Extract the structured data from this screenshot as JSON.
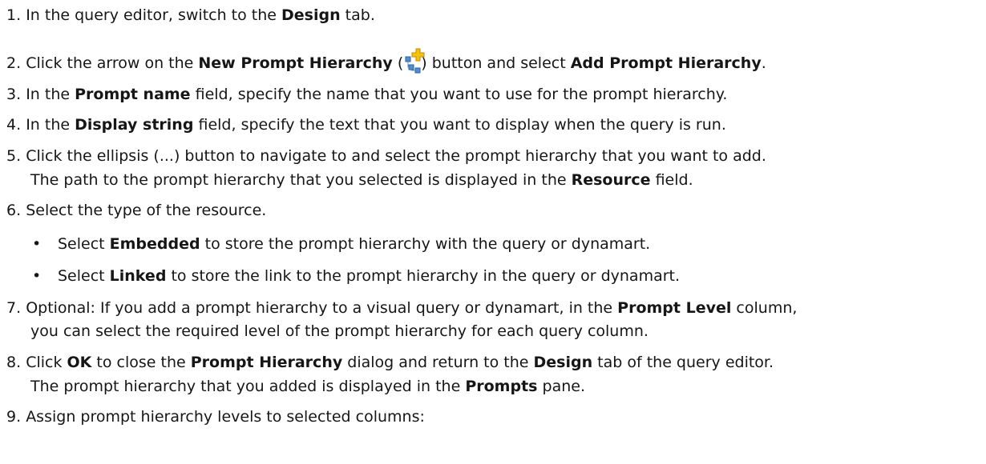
{
  "steps": [
    {
      "num": "1.",
      "pre": "In the query editor, switch to the ",
      "bold": "Design",
      "post": " tab."
    },
    {
      "num": "2.",
      "pre": "Click the arrow on the ",
      "bold1": "New Prompt Hierarchy",
      "mid1": " (",
      "icon": "new-prompt-hierarchy-icon",
      "mid2": ") button and select ",
      "bold2": "Add Prompt Hierarchy",
      "post": "."
    },
    {
      "num": "3.",
      "pre": "In the ",
      "bold": "Prompt name",
      "post": " field, specify the name that you want to use for the prompt hierarchy."
    },
    {
      "num": "4.",
      "pre": "In the ",
      "bold": "Display string",
      "post": " field, specify the text that you want to display when the query is run."
    },
    {
      "num": "5.",
      "text": "Click the ellipsis (...) button to navigate to and select the prompt hierarchy that you want to add.",
      "sub_pre": "The path to the prompt hierarchy that you selected is displayed in the ",
      "sub_bold": "Resource",
      "sub_post": " field."
    },
    {
      "num": "6.",
      "text": "Select the type of the resource.",
      "bullets": [
        {
          "pre": "Select ",
          "bold": "Embedded",
          "post": " to store the prompt hierarchy with the query or dynamart."
        },
        {
          "pre": "Select ",
          "bold": "Linked",
          "post": " to store the link to the prompt hierarchy in the query or dynamart."
        }
      ]
    },
    {
      "num": "7.",
      "pre": "Optional: If you add a prompt hierarchy to a visual query or dynamart, in the ",
      "bold": "Prompt Level",
      "post": " column,",
      "line2": "you can select the required level of the prompt hierarchy for each query column."
    },
    {
      "num": "8.",
      "pre": "Click ",
      "bold1": "OK",
      "mid1": " to close the ",
      "bold2": "Prompt Hierarchy",
      "mid2": " dialog and return to the ",
      "bold3": "Design",
      "post": " tab of the query editor.",
      "sub_pre": "The prompt hierarchy that you added is displayed in the ",
      "sub_bold": "Prompts",
      "sub_post": " pane."
    },
    {
      "num": "9.",
      "text": "Assign prompt hierarchy levels to selected columns:"
    }
  ],
  "bullet_char": "•"
}
